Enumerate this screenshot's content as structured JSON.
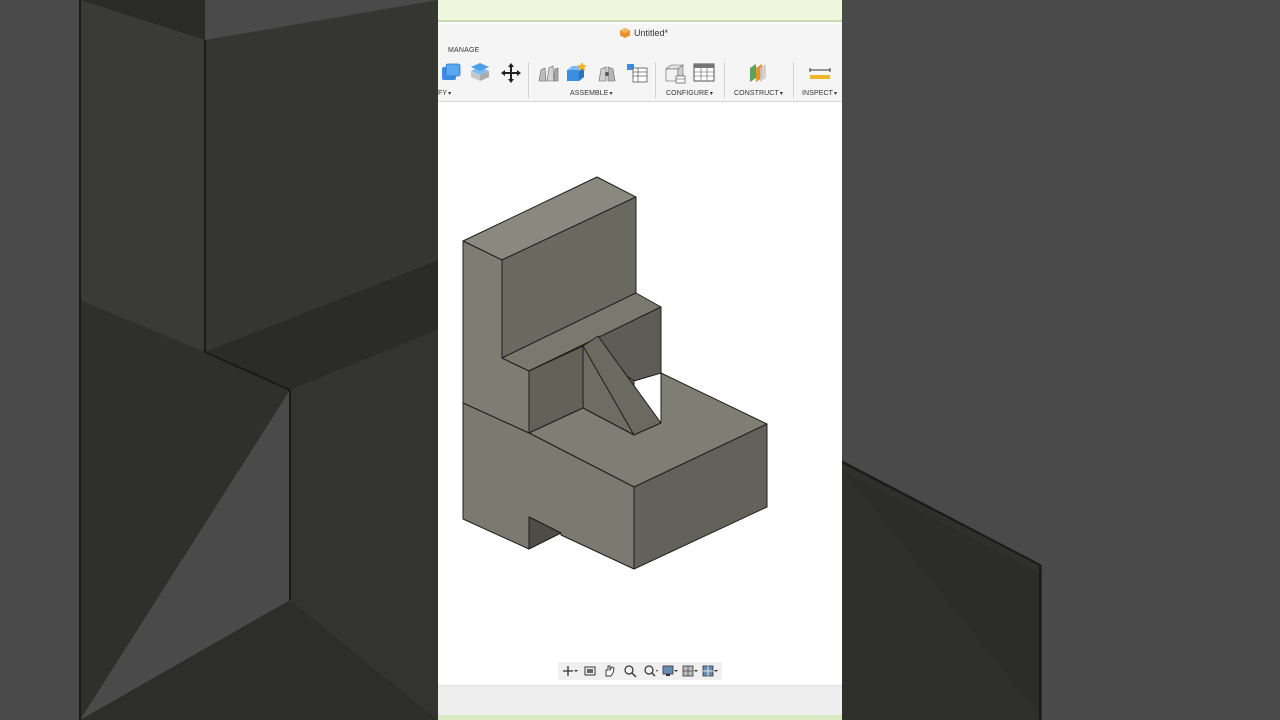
{
  "window": {
    "title": "Untitled*"
  },
  "toolbar": {
    "active_tab": "MANAGE",
    "groups": [
      {
        "label": "FY",
        "has_menu": true
      },
      {
        "label": "ASSEMBLE",
        "has_menu": true
      },
      {
        "label": "CONFIGURE",
        "has_menu": true
      },
      {
        "label": "CONSTRUCT",
        "has_menu": true
      },
      {
        "label": "INSPECT",
        "has_menu": true
      }
    ],
    "tools": [
      "combine-icon",
      "press-pull-icon",
      "move-icon",
      "joint-icon",
      "new-component-icon",
      "as-built-joint-icon",
      "bill-of-materials-icon",
      "configure-icon",
      "configuration-table-icon",
      "offset-plane-icon",
      "measure-icon"
    ]
  },
  "navigation_bar": {
    "items": [
      "orbit-icon",
      "look-at-icon",
      "pan-icon",
      "zoom-icon",
      "fit-icon",
      "display-settings-icon",
      "grid-settings-icon",
      "viewports-icon"
    ]
  },
  "colors": {
    "model_face_dark": "#595850",
    "model_face_mid": "#68675f",
    "model_face_light": "#7a7970",
    "viewport_bg": "#ffffff",
    "accent_orange": "#e8922e",
    "accent_blue": "#3a8ee0"
  }
}
